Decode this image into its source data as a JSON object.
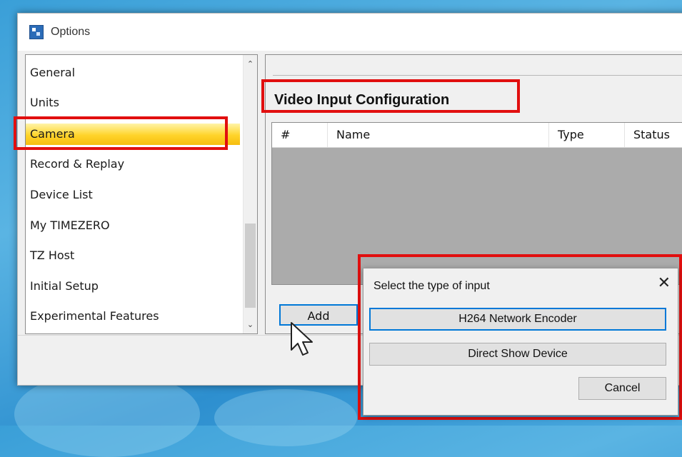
{
  "window": {
    "title": "Options",
    "icon": "options-app-icon"
  },
  "sidebar": {
    "items": [
      {
        "label": "General",
        "selected": false
      },
      {
        "label": "Units",
        "selected": false
      },
      {
        "label": "Camera",
        "selected": true
      },
      {
        "label": "Record & Replay",
        "selected": false
      },
      {
        "label": "Device List",
        "selected": false
      },
      {
        "label": "My TIMEZERO",
        "selected": false
      },
      {
        "label": "TZ Host",
        "selected": false
      },
      {
        "label": "Initial Setup",
        "selected": false
      },
      {
        "label": "Experimental Features",
        "selected": false
      }
    ],
    "scroll_up_icon": "chevron-up-icon",
    "scroll_down_icon": "chevron-down-icon"
  },
  "main": {
    "section_title": "Video Input Configuration",
    "table": {
      "columns": [
        "#",
        "Name",
        "Type",
        "Status"
      ],
      "rows": []
    },
    "add_label": "Add"
  },
  "dialog": {
    "title": "Select the type of input",
    "close_icon": "close-icon",
    "options": [
      {
        "label": "H264 Network Encoder",
        "focused": true
      },
      {
        "label": "Direct Show Device",
        "focused": false
      }
    ],
    "cancel_label": "Cancel"
  },
  "colors": {
    "highlight": "#e10f0f",
    "selection": "#ffd42a",
    "focus": "#0078d7"
  }
}
